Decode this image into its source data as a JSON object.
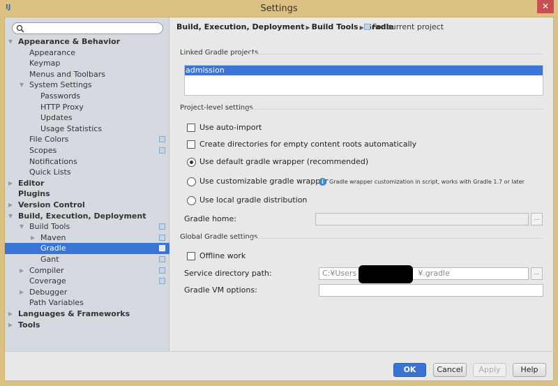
{
  "window": {
    "title": "Settings",
    "app_icon": "intellij-icon",
    "close_icon": "close-icon"
  },
  "sidebar": {
    "search_placeholder": "",
    "items": [
      {
        "label": "Appearance & Behavior",
        "level": 0,
        "bold": true,
        "arrow": "expanded"
      },
      {
        "label": "Appearance",
        "level": 1
      },
      {
        "label": "Keymap",
        "level": 1
      },
      {
        "label": "Menus and Toolbars",
        "level": 1
      },
      {
        "label": "System Settings",
        "level": 1,
        "arrow": "expanded"
      },
      {
        "label": "Passwords",
        "level": 2
      },
      {
        "label": "HTTP Proxy",
        "level": 2
      },
      {
        "label": "Updates",
        "level": 2
      },
      {
        "label": "Usage Statistics",
        "level": 2
      },
      {
        "label": "File Colors",
        "level": 1,
        "project": true
      },
      {
        "label": "Scopes",
        "level": 1,
        "project": true
      },
      {
        "label": "Notifications",
        "level": 1
      },
      {
        "label": "Quick Lists",
        "level": 1
      },
      {
        "label": "Editor",
        "level": 0,
        "bold": true,
        "arrow": "collapsed"
      },
      {
        "label": "Plugins",
        "level": 0,
        "bold": true
      },
      {
        "label": "Version Control",
        "level": 0,
        "bold": true,
        "arrow": "collapsed"
      },
      {
        "label": "Build, Execution, Deployment",
        "level": 0,
        "bold": true,
        "arrow": "expanded"
      },
      {
        "label": "Build Tools",
        "level": 1,
        "arrow": "expanded",
        "project": true
      },
      {
        "label": "Maven",
        "level": 2,
        "arrow": "collapsed",
        "project": true
      },
      {
        "label": "Gradle",
        "level": 2,
        "project": true,
        "selected": true
      },
      {
        "label": "Gant",
        "level": 2,
        "project": true
      },
      {
        "label": "Compiler",
        "level": 1,
        "arrow": "collapsed",
        "project": true
      },
      {
        "label": "Coverage",
        "level": 1,
        "project": true
      },
      {
        "label": "Debugger",
        "level": 1,
        "arrow": "collapsed"
      },
      {
        "label": "Path Variables",
        "level": 1
      },
      {
        "label": "Languages & Frameworks",
        "level": 0,
        "bold": true,
        "arrow": "collapsed"
      },
      {
        "label": "Tools",
        "level": 0,
        "bold": true,
        "arrow": "collapsed"
      }
    ]
  },
  "main": {
    "breadcrumb": [
      "Build, Execution, Deployment",
      "Build Tools",
      "Gradle"
    ],
    "scope_label": "For current project",
    "linked_section": "Linked Gradle projects",
    "linked_projects": [
      "admission"
    ],
    "project_section": "Project-level settings",
    "use_auto_import": {
      "label": "Use auto-import",
      "checked": false
    },
    "create_dirs": {
      "label": "Create directories for empty content roots automatically",
      "checked": false
    },
    "radio_default": {
      "label": "Use default gradle wrapper (recommended)",
      "selected": true
    },
    "radio_custom": {
      "label": "Use customizable gradle wrapper",
      "selected": false
    },
    "radio_custom_hint": "Gradle wrapper customization in script, works with Gradle 1.7 or later",
    "radio_local": {
      "label": "Use local gradle distribution",
      "selected": false
    },
    "gradle_home_label": "Gradle home:",
    "gradle_home_value": "",
    "global_section": "Global Gradle settings",
    "offline_work": {
      "label": "Offline work",
      "checked": false
    },
    "service_dir_label": "Service directory path:",
    "service_dir_value_prefix": "C:¥Users",
    "service_dir_value_suffix": "¥.gradle",
    "vm_options_label": "Gradle VM options:",
    "vm_options_value": "",
    "browse_label": "..."
  },
  "buttons": {
    "ok": "OK",
    "cancel": "Cancel",
    "apply": "Apply",
    "help": "Help"
  },
  "colors": {
    "accent": "#3875d7",
    "frame": "#dcc183",
    "close": "#c75050"
  }
}
